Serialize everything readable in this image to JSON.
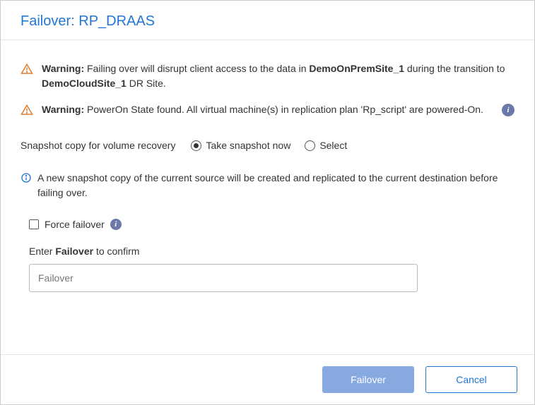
{
  "header": {
    "title": "Failover: RP_DRAAS"
  },
  "warnings": [
    {
      "label": "Warning:",
      "pre": " Failing over will disrupt client access to the data in ",
      "bold1": "DemoOnPremSite_1",
      "mid": " during the transition to ",
      "bold2": "DemoCloudSite_1",
      "post": " DR Site.",
      "hasInfo": false
    },
    {
      "label": "Warning:",
      "pre": " PowerOn State found. All virtual machine(s) in replication plan 'Rp_script' are powered-On.",
      "bold1": "",
      "mid": "",
      "bold2": "",
      "post": "",
      "hasInfo": true
    }
  ],
  "snapshot": {
    "label": "Snapshot copy for volume recovery",
    "option1": "Take snapshot now",
    "option2": "Select",
    "selected": "option1"
  },
  "infoNote": "A new snapshot copy of the current source will be created and replicated to the current destination before failing over.",
  "forceFailover": {
    "label": "Force failover",
    "checked": false
  },
  "confirm": {
    "pre": "Enter ",
    "bold": "Failover",
    "post": " to confirm",
    "placeholder": "Failover"
  },
  "footer": {
    "primary": "Failover",
    "secondary": "Cancel"
  }
}
